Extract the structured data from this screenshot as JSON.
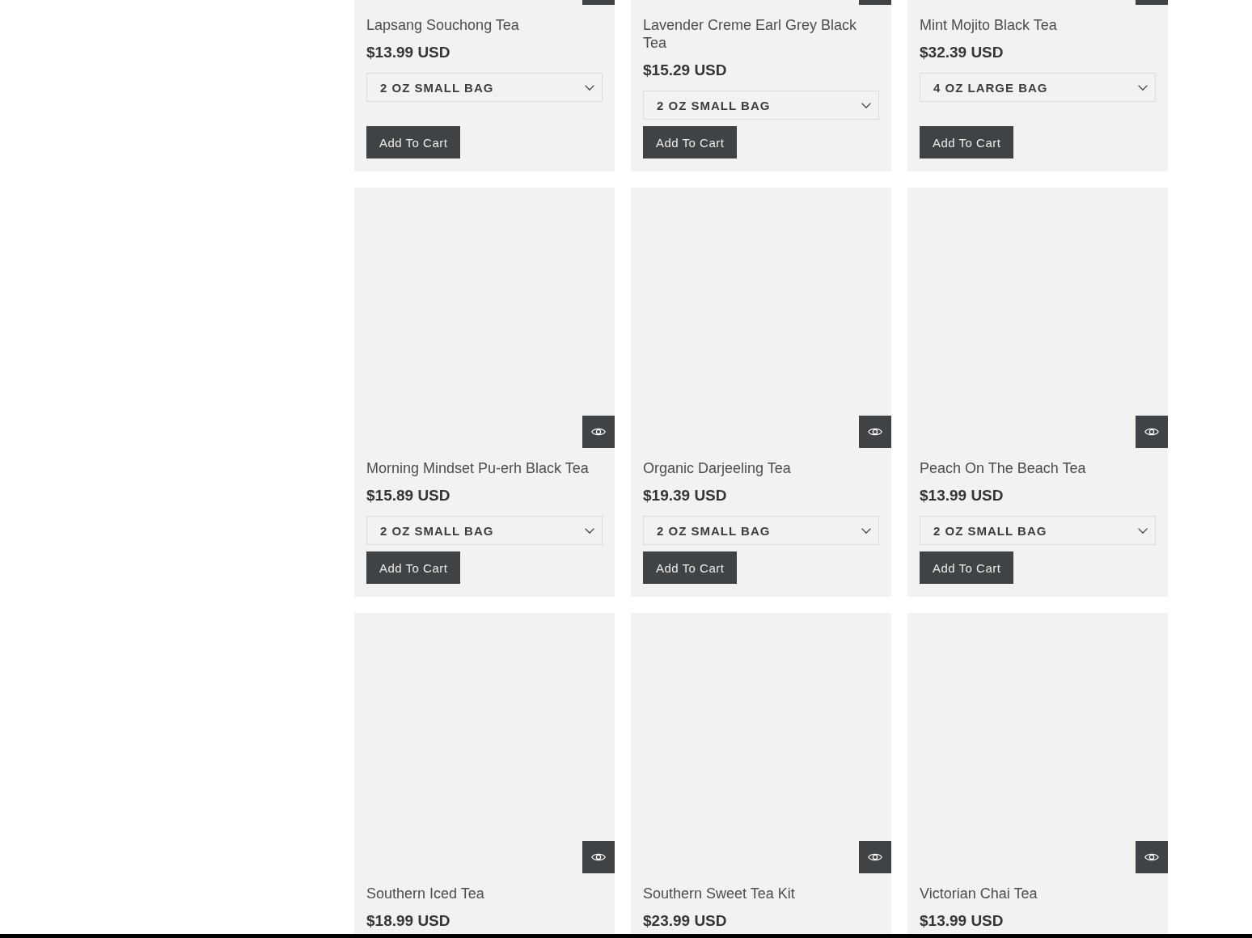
{
  "products": [
    {
      "name": "Lapsang Souchong Tea",
      "price": "$13.99 USD",
      "size": "2 OZ SMALL BAG",
      "button": "Add To Cart"
    },
    {
      "name": "Lavender Creme Earl Grey Black Tea",
      "price": "$15.29 USD",
      "size": "2 OZ SMALL BAG",
      "button": "Add To Cart"
    },
    {
      "name": "Mint Mojito Black Tea",
      "price": "$32.39 USD",
      "size": "4 OZ LARGE BAG",
      "button": "Add To Cart"
    },
    {
      "name": "Morning Mindset Pu-erh Black Tea",
      "price": "$15.89 USD",
      "size": "2 OZ SMALL BAG",
      "button": "Add To Cart"
    },
    {
      "name": "Organic Darjeeling Tea",
      "price": "$19.39 USD",
      "size": "2 OZ SMALL BAG",
      "button": "Add To Cart"
    },
    {
      "name": "Peach On The Beach Tea",
      "price": "$13.99 USD",
      "size": "2 OZ SMALL BAG",
      "button": "Add To Cart"
    },
    {
      "name": "Southern Iced Tea",
      "price": "$18.99 USD"
    },
    {
      "name": "Southern Sweet Tea Kit",
      "price": "$23.99 USD"
    },
    {
      "name": "Victorian Chai Tea",
      "price": "$13.99 USD"
    }
  ]
}
